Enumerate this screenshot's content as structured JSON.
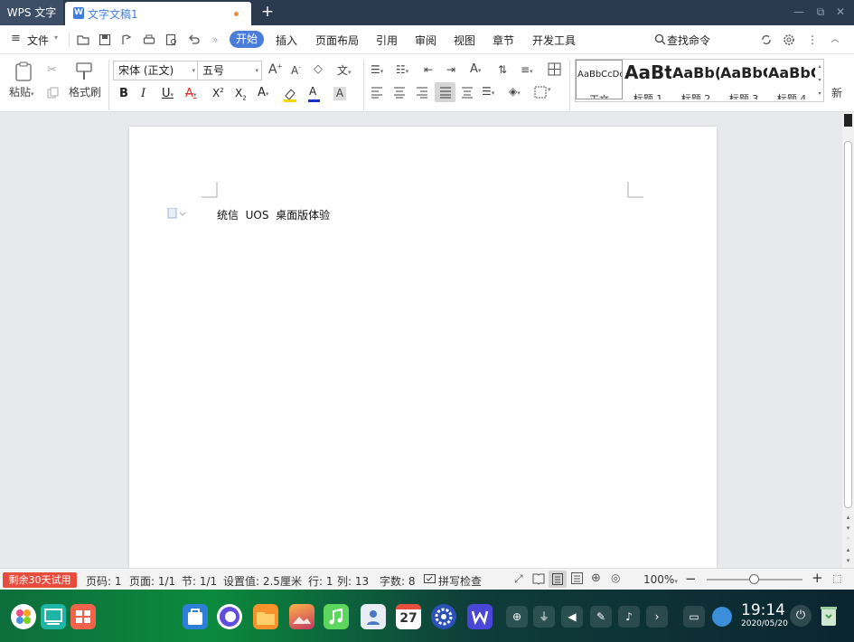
{
  "titlebar": {
    "app_title": "WPS 文字",
    "doc_tab": "文字文稿1",
    "new_tab": "+",
    "minimize": "—",
    "restore": "⧉",
    "close": "✕"
  },
  "menubar": {
    "file_label": "文件",
    "active_tab": "开始",
    "tabs": [
      "插入",
      "页面布局",
      "引用",
      "审阅",
      "视图",
      "章节",
      "开发工具"
    ],
    "search_label": "查找命令"
  },
  "ribbon": {
    "paste_label": "粘贴",
    "format_painter_label": "格式刷",
    "font_name": "宋体 (正文)",
    "font_size": "五号",
    "styles": [
      {
        "preview": "AaBbCcDd",
        "label": "正文"
      },
      {
        "preview": "AaBt",
        "label": "标题 1"
      },
      {
        "preview": "AaBb(",
        "label": "标题 2"
      },
      {
        "preview": "AaBbC",
        "label": "标题 3"
      },
      {
        "preview": "AaBbC",
        "label": "标题 4"
      }
    ],
    "new_style_label": "新"
  },
  "document": {
    "text": "统信  UOS  桌面版体验"
  },
  "statusbar": {
    "trial": "剩余30天试用",
    "page_num": "页码: 1",
    "pages": "页面: 1/1",
    "section": "节: 1/1",
    "setting": "设置值: 2.5厘米",
    "row": "行: 1",
    "col": "列: 13",
    "word_count": "字数: 8",
    "spell_check": "拼写检查",
    "zoom": "100%",
    "zoom_fraction": 0.5
  },
  "taskbar": {
    "time": "19:14",
    "date": "2020/05/20",
    "calendar_day": "27"
  }
}
